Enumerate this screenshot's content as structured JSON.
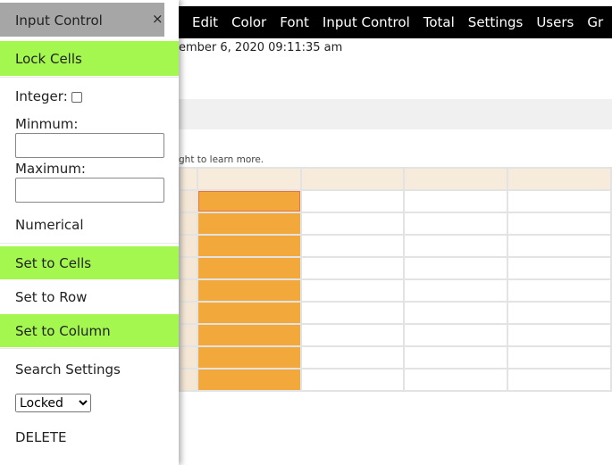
{
  "nav": {
    "items": [
      "Edit",
      "Color",
      "Font",
      "Input Control",
      "Total",
      "Settings",
      "Users",
      "Gr"
    ]
  },
  "timestamp": "ember 6, 2020 09:11:35 am",
  "hint": "ght to learn more.",
  "panel": {
    "title": "Input Control",
    "close": "×",
    "lock_cells": "Lock Cells",
    "integer_label": "Integer:",
    "minimum_label": "Minmum:",
    "minimum_value": "",
    "maximum_label": "Maximum:",
    "maximum_value": "",
    "numerical": "Numerical",
    "set_to_cells": "Set to Cells",
    "set_to_row": "Set to Row",
    "set_to_column": "Set to Column",
    "search_settings": "Search Settings",
    "select_value": "Locked",
    "delete": "DELETE"
  },
  "colors": {
    "green": "#a3f74f",
    "locked_cell": "#f3a83c",
    "header": "#f7ebdb"
  },
  "grid": {
    "rows": 9,
    "columns": 4,
    "locked_column": 1
  }
}
